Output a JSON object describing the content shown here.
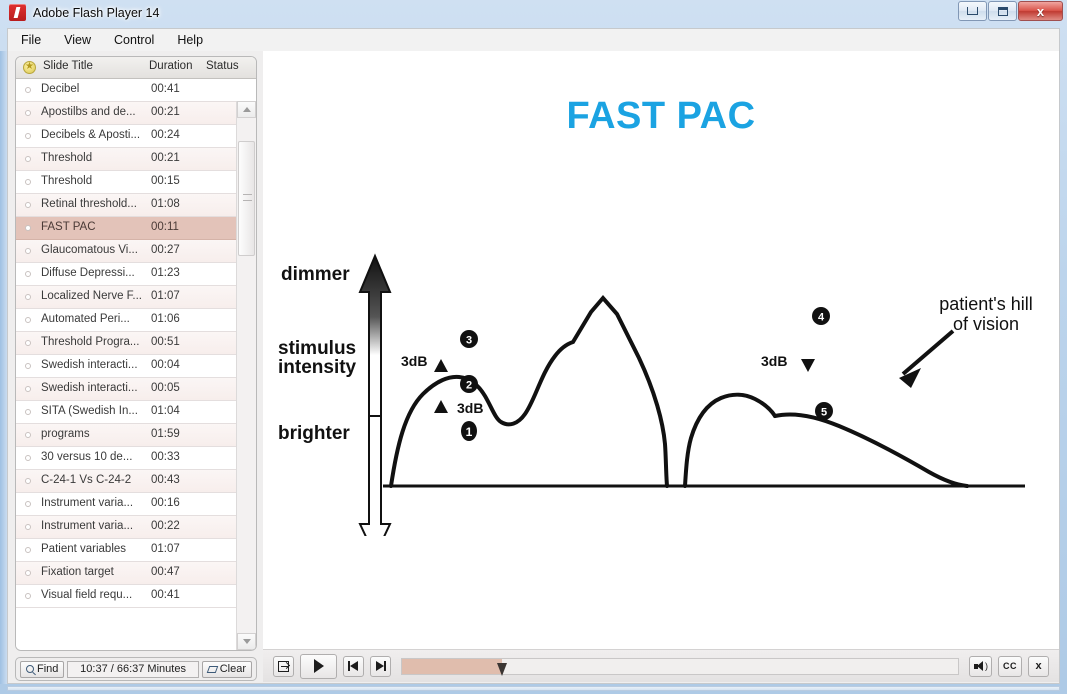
{
  "window": {
    "title": "Adobe Flash Player 14",
    "logo_icon": "flash-logo-icon",
    "buttons": {
      "minimize": "minimize-icon",
      "maximize": "maximize-icon",
      "close": "x"
    }
  },
  "menubar": {
    "items": [
      {
        "label": "File"
      },
      {
        "label": "View"
      },
      {
        "label": "Control"
      },
      {
        "label": "Help"
      }
    ]
  },
  "sidebar": {
    "header": {
      "star_icon": "star-icon",
      "col_title": "Slide Title",
      "col_duration": "Duration",
      "col_status": "Status"
    },
    "rows": [
      {
        "title": "Decibel",
        "duration": "00:41",
        "selected": false
      },
      {
        "title": "Apostilbs and de...",
        "duration": "00:21",
        "selected": false
      },
      {
        "title": "Decibels & Aposti...",
        "duration": "00:24",
        "selected": false
      },
      {
        "title": "Threshold",
        "duration": "00:21",
        "selected": false
      },
      {
        "title": "Threshold",
        "duration": "00:15",
        "selected": false
      },
      {
        "title": "Retinal threshold...",
        "duration": "01:08",
        "selected": false
      },
      {
        "title": "FAST PAC",
        "duration": "00:11",
        "selected": true
      },
      {
        "title": "Glaucomatous Vi...",
        "duration": "00:27",
        "selected": false
      },
      {
        "title": "Diffuse Depressi...",
        "duration": "01:23",
        "selected": false
      },
      {
        "title": "Localized Nerve F...",
        "duration": "01:07",
        "selected": false
      },
      {
        "title": "Automated Peri...",
        "duration": "01:06",
        "selected": false
      },
      {
        "title": "Threshold Progra...",
        "duration": "00:51",
        "selected": false
      },
      {
        "title": "Swedish interacti...",
        "duration": "00:04",
        "selected": false
      },
      {
        "title": "Swedish interacti...",
        "duration": "00:05",
        "selected": false
      },
      {
        "title": "SITA (Swedish In...",
        "duration": "01:04",
        "selected": false
      },
      {
        "title": "programs",
        "duration": "01:59",
        "selected": false
      },
      {
        "title": "30 versus 10 de...",
        "duration": "00:33",
        "selected": false
      },
      {
        "title": "C-24-1 Vs C-24-2",
        "duration": "00:43",
        "selected": false
      },
      {
        "title": "Instrument varia...",
        "duration": "00:16",
        "selected": false
      },
      {
        "title": "Instrument varia...",
        "duration": "00:22",
        "selected": false
      },
      {
        "title": "Patient variables",
        "duration": "01:07",
        "selected": false
      },
      {
        "title": "Fixation target",
        "duration": "00:47",
        "selected": false
      },
      {
        "title": "Visual field requ...",
        "duration": "00:41",
        "selected": false
      }
    ],
    "bottom": {
      "find_label": "Find",
      "find_icon": "magnifier-icon",
      "time_label": "10:37 / 66:37 Minutes",
      "clear_label": "Clear",
      "clear_icon": "eraser-icon"
    }
  },
  "slide": {
    "title": "FAST PAC",
    "title_color": "#1ba3e2",
    "diagram": {
      "axis_label_top": "dimmer",
      "axis_label_middle_line1": "stimulus",
      "axis_label_middle_line2": "intensity",
      "axis_label_bottom": "brighter",
      "callout_line1": "patient's hill",
      "callout_line2": "of vision",
      "markers": [
        {
          "id": "1",
          "label": "1"
        },
        {
          "id": "2",
          "label": "2"
        },
        {
          "id": "3",
          "label": "3"
        },
        {
          "id": "4",
          "label": "4"
        },
        {
          "id": "5",
          "label": "5"
        }
      ],
      "step_labels": [
        {
          "text": "3dB",
          "arrow": "▲",
          "position": "upper-left"
        },
        {
          "text": "3dB",
          "arrow": "▲",
          "position": "lower-left"
        },
        {
          "text": "3dB",
          "arrow": "▼",
          "position": "right"
        }
      ]
    }
  },
  "player": {
    "exit_icon": "exit-icon",
    "play_icon": "play-icon",
    "prev_icon": "skip-previous-icon",
    "next_icon": "skip-next-icon",
    "volume_icon": "volume-icon",
    "cc_label": "CC",
    "close_label": "x",
    "progress_percent": 18
  }
}
